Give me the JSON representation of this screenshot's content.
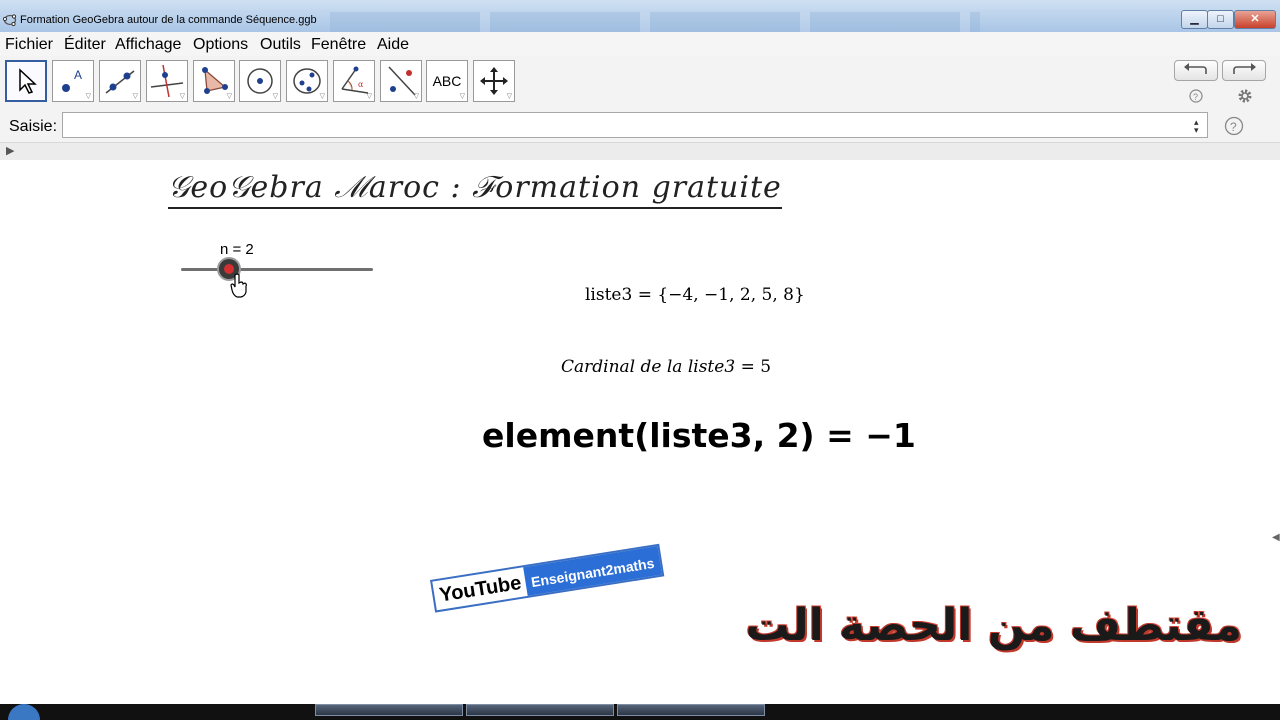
{
  "window": {
    "title": "Formation GeoGebra autour de la commande Séquence.ggb",
    "minimize_label": "▁",
    "maximize_label": "□",
    "close_label": "✕"
  },
  "menu": {
    "items": [
      "Fichier",
      "Éditer",
      "Affichage",
      "Options",
      "Outils",
      "Fenêtre",
      "Aide"
    ]
  },
  "toolbar": {
    "tools": [
      "move-tool",
      "point-tool",
      "line-tool",
      "perpendicular-tool",
      "polygon-tool",
      "circle-tool",
      "conic-tool",
      "angle-tool",
      "reflect-tool",
      "text-tool",
      "move-graphics-tool"
    ],
    "text_tool_label": "ABC",
    "undo_icon": "undo-icon",
    "redo_icon": "redo-icon",
    "help_icon": "help-icon",
    "settings_icon": "gear-icon"
  },
  "input_bar": {
    "label": "Saisie:",
    "value": "",
    "help_icon": "help-icon"
  },
  "graphics": {
    "title": "𝒢eo𝒢ebra ℳaroc  :  ℱormation gratuite",
    "slider": {
      "label": "n = 2",
      "value": 2,
      "fraction": 0.25
    },
    "liste_line": "liste3  =  {−4, −1, 2, 5, 8}",
    "cardinal_prefix": "Cardinal de la liste3",
    "cardinal_value": "=  5",
    "element_line": "element(liste3, 2)  =  −1"
  },
  "overlay": {
    "youtube_word": "YouTube",
    "channel_name": "Enseignant2maths",
    "arabic_caption": "مقتطف من الحصة الت"
  },
  "colors": {
    "slider_point": "#d23030",
    "youtube_blue": "#2b6fd6",
    "caption_outline": "#c0392b"
  }
}
